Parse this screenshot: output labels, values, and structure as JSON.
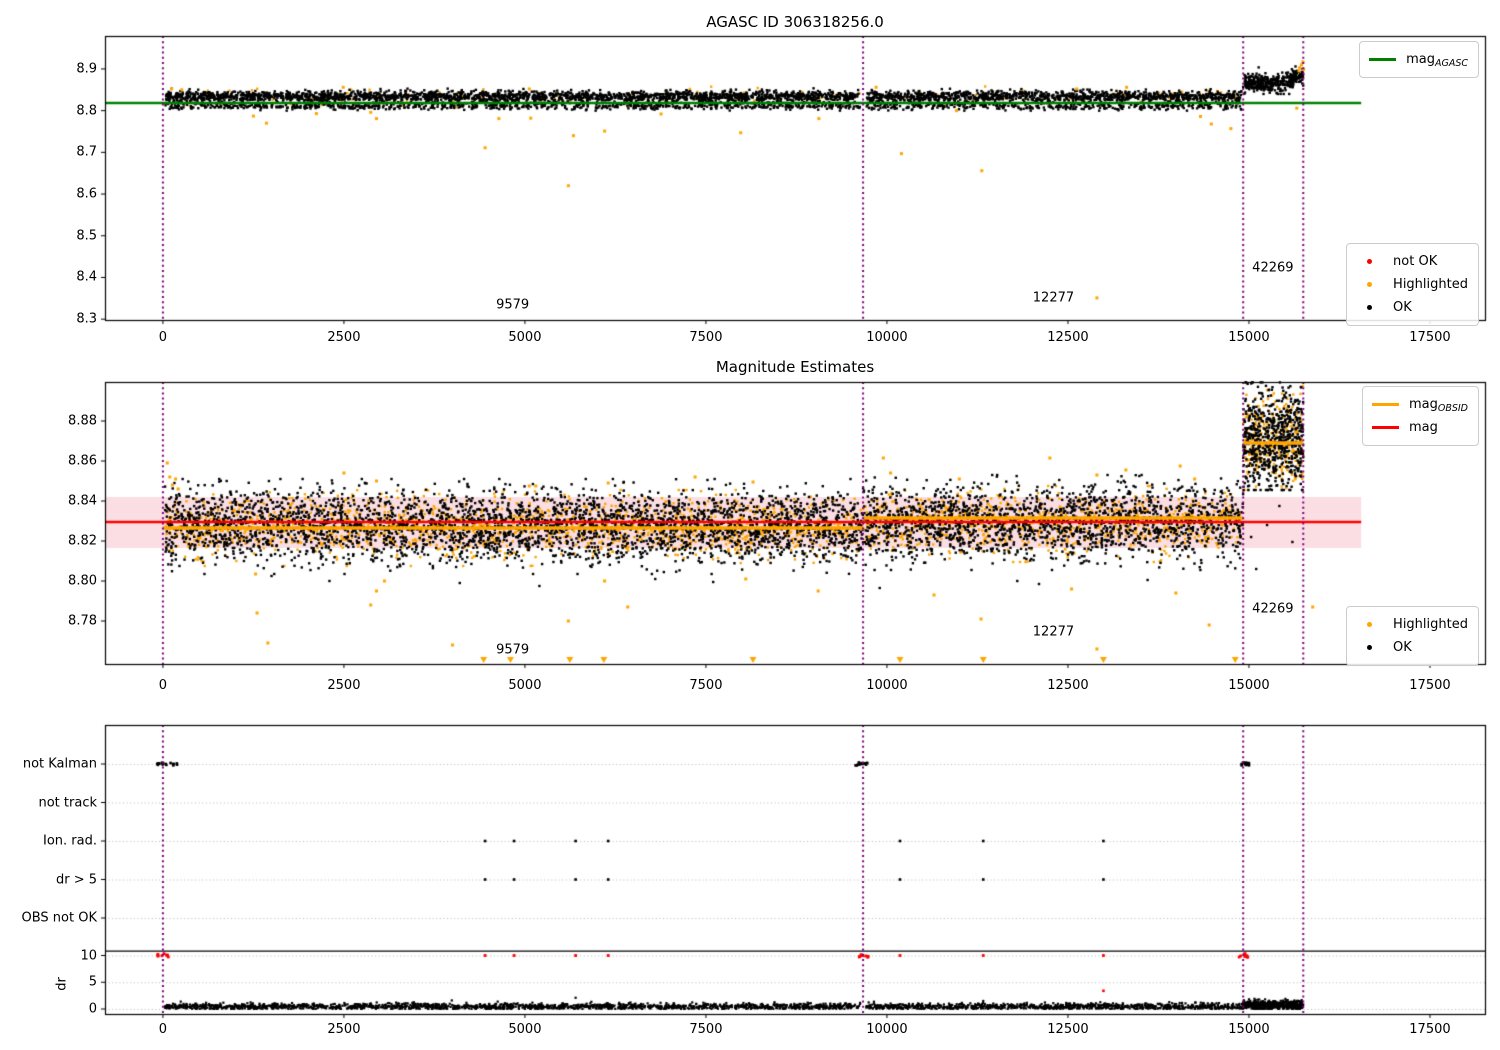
{
  "figure": {
    "background": "#ffffff"
  },
  "colors": {
    "ok": "#000000",
    "highlighted": "#ffa500",
    "not_ok": "#ff0000",
    "mag_agasc_line": "#008000",
    "mag_obsid_line": "#ffa500",
    "mag_line": "#ff0000",
    "vline": "#800080",
    "band": "#fbdee3",
    "grid": "#b8b8b8",
    "spine": "#000000"
  },
  "legends": {
    "p1_line": {
      "items": [
        {
          "main": "mag",
          "sub": "AGASC",
          "color": "#008000"
        }
      ]
    },
    "p1_dots": {
      "items": [
        {
          "label": "not OK",
          "color": "#ff0000"
        },
        {
          "label": "Highlighted",
          "color": "#ffa500"
        },
        {
          "label": "OK",
          "color": "#000000"
        }
      ]
    },
    "p2_lines": {
      "items": [
        {
          "main": "mag",
          "sub": "OBSID",
          "color": "#ffa500"
        },
        {
          "main": "mag",
          "sub": "",
          "color": "#ff0000"
        }
      ]
    },
    "p2_dots": {
      "items": [
        {
          "label": "Highlighted",
          "color": "#ffa500"
        },
        {
          "label": "OK",
          "color": "#000000"
        }
      ]
    }
  },
  "chart_data": [
    {
      "type": "scatter",
      "title": "AGASC ID 306318256.0",
      "xlim": [
        -800,
        18260
      ],
      "ylim": [
        8.298,
        8.979
      ],
      "xticks": [
        0,
        2500,
        5000,
        7500,
        10000,
        12500,
        15000,
        17500
      ],
      "yticks": [
        {
          "v": 8.9,
          "label": "8.9"
        },
        {
          "v": 8.8,
          "label": "8.8"
        },
        {
          "v": 8.7,
          "label": "8.7"
        },
        {
          "v": 8.6,
          "label": "8.6"
        },
        {
          "v": 8.5,
          "label": "8.5"
        },
        {
          "v": 8.4,
          "label": "8.4"
        },
        {
          "v": 8.3,
          "label": "8.3"
        }
      ],
      "vlines": [
        0,
        9670,
        14920,
        15750
      ],
      "lines": [
        {
          "v": 8.8185,
          "x0": -800,
          "x1": 16550,
          "color": "#008000",
          "w": 2.5,
          "label": "mag_AGASC"
        }
      ],
      "scatter": [
        {
          "n": 160,
          "x0": 30,
          "x1": 14920,
          "c": 8.832,
          "s": 0.0105,
          "clip": [
            8.802,
            8.858
          ],
          "color": "#ffa500",
          "gaps": [
            {
              "x": 9670,
              "r": 45
            },
            {
              "x": 14920,
              "r": 25
            }
          ]
        },
        {
          "n": 3300,
          "x0": 30,
          "x1": 14920,
          "c": 8.8335,
          "s": 0.0068,
          "clip": [
            8.818,
            8.856
          ],
          "color": "#000000",
          "gaps": [
            {
              "x": 9670,
              "r": 45
            },
            {
              "x": 14920,
              "r": 25
            }
          ]
        },
        {
          "n": 1100,
          "x0": 30,
          "x1": 14920,
          "c": 8.8105,
          "s": 0.004,
          "clip": [
            8.8,
            8.818
          ],
          "color": "#000000",
          "gaps": [
            {
              "x": 9670,
              "r": 45
            },
            {
              "x": 14920,
              "r": 25
            }
          ]
        },
        {
          "n": 380,
          "x0": 14920,
          "x1": 15750,
          "c": 8.8665,
          "s": 0.0105,
          "clip": [
            8.84,
            8.925
          ],
          "color": "#000000",
          "tail": {
            "x": 15500,
            "k": 9e-05
          }
        }
      ],
      "points": [
        [
          1250,
          8.787
        ],
        [
          1430,
          8.77
        ],
        [
          2120,
          8.793
        ],
        [
          2870,
          8.796
        ],
        [
          2950,
          8.781
        ],
        [
          4450,
          8.711
        ],
        [
          4640,
          8.781
        ],
        [
          5080,
          8.782
        ],
        [
          5600,
          8.62
        ],
        [
          5670,
          8.74
        ],
        [
          6100,
          8.751
        ],
        [
          6880,
          8.792
        ],
        [
          7980,
          8.747
        ],
        [
          9060,
          8.781
        ],
        [
          10200,
          8.697
        ],
        [
          10960,
          8.8
        ],
        [
          11310,
          8.656
        ],
        [
          12900,
          8.351
        ],
        [
          14330,
          8.786
        ],
        [
          14480,
          8.768
        ],
        [
          14750,
          8.757
        ],
        [
          15660,
          8.806
        ],
        [
          120,
          8.852
        ],
        [
          260,
          8.85
        ],
        [
          2490,
          8.856
        ],
        [
          5060,
          8.852
        ],
        [
          9850,
          8.856
        ],
        [
          12620,
          8.852
        ],
        [
          13310,
          8.856
        ],
        [
          15690,
          8.8955
        ],
        [
          15700,
          8.903
        ],
        [
          15725,
          8.91
        ],
        [
          15745,
          8.917
        ],
        [
          15755,
          8.899
        ]
      ],
      "annotations": [
        {
          "text": "9579",
          "x": 4830,
          "v": 8.335
        },
        {
          "text": "12277",
          "x": 12300,
          "v": 8.351
        },
        {
          "text": "42269",
          "x": 15330,
          "v": 8.423
        }
      ]
    },
    {
      "type": "scatter",
      "title": "Magnitude Estimates",
      "xlim": [
        -800,
        18260
      ],
      "ylim": [
        8.7585,
        8.8995
      ],
      "xticks": [
        0,
        2500,
        5000,
        7500,
        10000,
        12500,
        15000,
        17500
      ],
      "yticks": [
        {
          "v": 8.88,
          "label": "8.88"
        },
        {
          "v": 8.86,
          "label": "8.86"
        },
        {
          "v": 8.84,
          "label": "8.84"
        },
        {
          "v": 8.82,
          "label": "8.82"
        },
        {
          "v": 8.8,
          "label": "8.80"
        },
        {
          "v": 8.78,
          "label": "8.78"
        }
      ],
      "vlines": [
        0,
        9670,
        14920,
        15750
      ],
      "band": {
        "v0": 8.8165,
        "v1": 8.842,
        "x0": -800,
        "x1": 16550,
        "color": "#fbdee3"
      },
      "lines": [
        {
          "v": 8.8295,
          "x0": -800,
          "x1": 16550,
          "color": "#ff0000",
          "w": 2.5,
          "label": "mag"
        },
        {
          "v": 8.8265,
          "x0": 0,
          "x1": 9670,
          "color": "#ffa500",
          "w": 3.5,
          "label": "mag_OBSID"
        },
        {
          "v": 8.8315,
          "x0": 9670,
          "x1": 14920,
          "color": "#ffa500",
          "w": 3.5,
          "label": "mag_OBSID"
        },
        {
          "v": 8.869,
          "x0": 14920,
          "x1": 15750,
          "color": "#ffa500",
          "w": 3.5,
          "label": "mag_OBSID"
        }
      ],
      "scatter": [
        {
          "n": 1500,
          "x0": 30,
          "x1": 9670,
          "c": 8.8265,
          "s": 0.0075,
          "clip": [
            8.8075,
            8.8455
          ],
          "color": "#ffa500"
        },
        {
          "n": 3300,
          "x0": 30,
          "x1": 9670,
          "c": 8.8275,
          "s": 0.0092,
          "clip": [
            8.8035,
            8.851
          ],
          "color": "#000000"
        },
        {
          "n": 800,
          "x0": 9670,
          "x1": 14920,
          "c": 8.8285,
          "s": 0.0075,
          "clip": [
            8.8095,
            8.8475
          ],
          "color": "#ffa500"
        },
        {
          "n": 1800,
          "x0": 9670,
          "x1": 14920,
          "c": 8.8295,
          "s": 0.0092,
          "clip": [
            8.8055,
            8.853
          ],
          "color": "#000000"
        },
        {
          "n": 300,
          "x0": 14920,
          "x1": 15750,
          "c": 8.869,
          "s": 0.011,
          "clip": [
            8.8455,
            8.8985
          ],
          "color": "#ffa500"
        },
        {
          "n": 650,
          "x0": 14920,
          "x1": 15750,
          "c": 8.871,
          "s": 0.0125,
          "clip": [
            8.8455,
            8.8993
          ],
          "color": "#000000"
        }
      ],
      "points": [
        [
          1280,
          8.8035
        ],
        [
          1300,
          8.784
        ],
        [
          1450,
          8.769
        ],
        [
          2870,
          8.788
        ],
        [
          2950,
          8.795
        ],
        [
          3060,
          8.8
        ],
        [
          4000,
          8.768
        ],
        [
          5600,
          8.78
        ],
        [
          6100,
          8.8
        ],
        [
          6420,
          8.787
        ],
        [
          8050,
          8.801
        ],
        [
          9050,
          8.795
        ],
        [
          10650,
          8.793
        ],
        [
          11300,
          8.781
        ],
        [
          12550,
          8.796
        ],
        [
          13990,
          8.794
        ],
        [
          14450,
          8.778
        ],
        [
          12900,
          8.766
        ],
        [
          15880,
          8.787
        ],
        [
          60,
          8.859
        ],
        [
          95,
          8.852
        ],
        [
          130,
          8.848
        ],
        [
          175,
          8.851
        ],
        [
          210,
          8.846
        ],
        [
          2500,
          8.854
        ],
        [
          2950,
          8.85
        ],
        [
          5060,
          8.8475
        ],
        [
          5150,
          8.8475
        ],
        [
          6150,
          8.849
        ],
        [
          7350,
          8.852
        ],
        [
          8150,
          8.8495
        ],
        [
          9950,
          8.8615
        ],
        [
          10050,
          8.854
        ],
        [
          11000,
          8.851
        ],
        [
          12250,
          8.8615
        ],
        [
          12900,
          8.853
        ],
        [
          13300,
          8.8555
        ],
        [
          14050,
          8.8575
        ],
        [
          14250,
          8.851
        ]
      ],
      "points_black": [
        [
          1500,
          8.8025
        ],
        [
          2300,
          8.8
        ],
        [
          4100,
          8.799
        ],
        [
          5200,
          8.7975
        ],
        [
          6800,
          8.801
        ],
        [
          7600,
          8.7995
        ],
        [
          9900,
          8.7965
        ],
        [
          11800,
          8.8
        ],
        [
          12100,
          8.7985
        ],
        [
          13600,
          8.8005
        ],
        [
          15030,
          8.822
        ],
        [
          15100,
          8.806
        ],
        [
          15250,
          8.828
        ],
        [
          15420,
          8.8375
        ],
        [
          15600,
          8.8195
        ]
      ],
      "triangles": [
        4430,
        4800,
        5620,
        6090,
        8150,
        10180,
        11330,
        12990,
        14810
      ],
      "annotations": [
        {
          "text": "9579",
          "x": 4830,
          "v": 8.7655
        },
        {
          "text": "12277",
          "x": 12300,
          "v": 8.7745
        },
        {
          "text": "42269",
          "x": 15330,
          "v": 8.786
        }
      ]
    },
    {
      "type": "flags",
      "xlim": [
        -800,
        18260
      ],
      "xticks": [
        0,
        2500,
        5000,
        7500,
        10000,
        12500,
        15000,
        17500
      ],
      "categories": [
        "not Kalman",
        "not track",
        "Ion. rad.",
        "dr > 5",
        "OBS not OK"
      ],
      "dr_ticks": [
        {
          "v": 10,
          "label": "10"
        },
        {
          "v": 5,
          "label": "5"
        },
        {
          "v": 0,
          "label": "0"
        }
      ],
      "ylabel": "dr",
      "vlines": [
        0,
        9670,
        14920,
        15750
      ],
      "solid_hline_dr": 10.8,
      "flags": {
        "not_kalman_segments": [
          [
            -80,
            200
          ],
          [
            9560,
            9800
          ],
          [
            14860,
            15010
          ]
        ],
        "ion_rad_x": [
          4450,
          4850,
          5700,
          6150,
          10180,
          11330,
          12990
        ],
        "dr_gt5_x": [
          4450,
          4850,
          5700,
          6150,
          10180,
          11330,
          12990
        ]
      },
      "dr_scatter": [
        {
          "n": 2600,
          "x0": 30,
          "x1": 14920,
          "c": 0.45,
          "s": 0.3,
          "clip": [
            0.03,
            1.5
          ],
          "color": "#000000",
          "gaps": [
            {
              "x": 9670,
              "r": 40
            }
          ]
        },
        {
          "n": 500,
          "x0": 14920,
          "x1": 15750,
          "c": 0.7,
          "s": 0.45,
          "clip": [
            0.03,
            2.5
          ],
          "color": "#000000"
        }
      ],
      "dr_red": {
        "clusters": [
          0,
          9670,
          14920
        ],
        "singles": [
          4450,
          4850,
          5700,
          6150,
          10180,
          11330,
          12990
        ],
        "extra": [
          [
            12990,
            3.4
          ]
        ]
      },
      "dr_black_extra": [
        [
          3990,
          1.6
        ],
        [
          5700,
          2.1
        ],
        [
          11330,
          1.5
        ]
      ]
    }
  ]
}
